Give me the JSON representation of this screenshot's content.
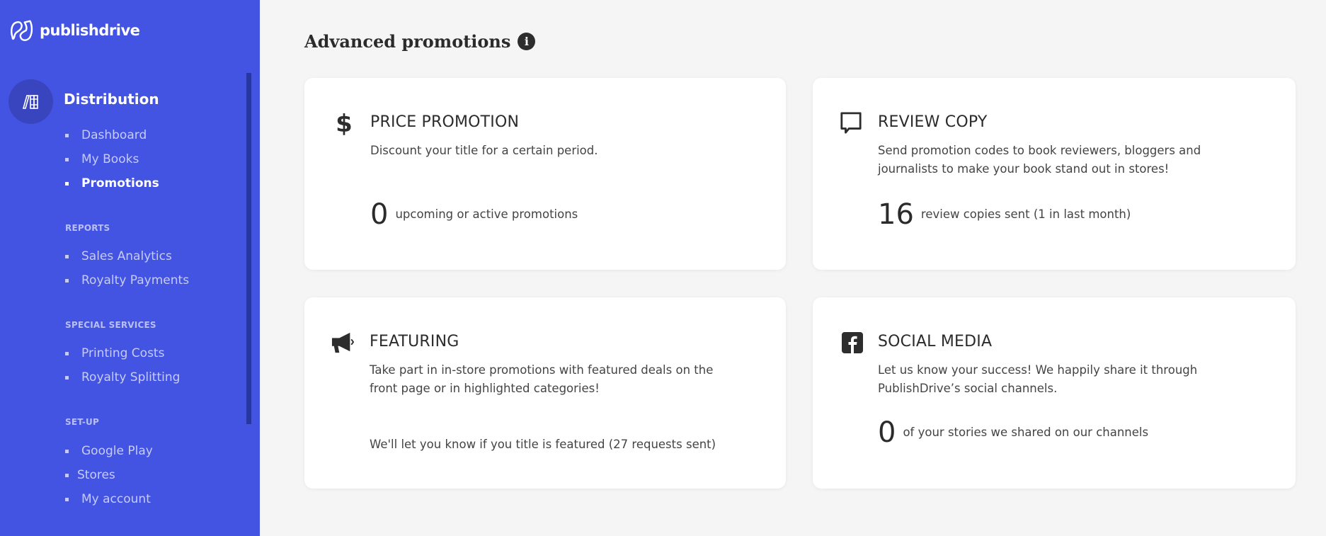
{
  "app": {
    "brand": "publishdrive",
    "accent_color": "#4353e2"
  },
  "sidebar": {
    "section_title": "Distribution",
    "section_icon": "books-icon",
    "distribution_items": [
      {
        "label": "Dashboard",
        "active": false
      },
      {
        "label": "My Books",
        "active": false
      },
      {
        "label": "Promotions",
        "active": true
      }
    ],
    "reports_label": "REPORTS",
    "reports_items": [
      {
        "label": "Sales Analytics"
      },
      {
        "label": "Royalty Payments"
      }
    ],
    "special_label": "SPECIAL SERVICES",
    "special_items": [
      {
        "label": "Printing Costs"
      },
      {
        "label": "Royalty Splitting"
      }
    ],
    "setup_label": "SET-UP",
    "setup_items": [
      {
        "label": "Google Play"
      },
      {
        "label": "Stores"
      },
      {
        "label": "My account"
      }
    ]
  },
  "main": {
    "title": "Advanced promotions",
    "info_icon": "i",
    "cards": [
      {
        "icon": "dollar-icon",
        "title": "PRICE PROMOTION",
        "description": "Discount your title for a certain period.",
        "stat_value": "0",
        "stat_text": "upcoming or active promotions"
      },
      {
        "icon": "speech-bubble-icon",
        "title": "REVIEW COPY",
        "description": "Send promotion codes to book reviewers, bloggers and journalists to make your book stand out in stores!",
        "stat_value": "16",
        "stat_text": "review copies sent (1 in last month)"
      },
      {
        "icon": "megaphone-icon",
        "title": "FEATURING",
        "description": "Take part in in-store promotions with featured deals on the front page or in highlighted categories!",
        "note": "We'll let you know if you title is featured (27 requests sent)"
      },
      {
        "icon": "facebook-icon",
        "title": "SOCIAL MEDIA",
        "description": "Let us know your success! We happily share it through PublishDrive’s social channels.",
        "stat_value": "0",
        "stat_text": "of your stories we shared on our channels"
      }
    ]
  }
}
